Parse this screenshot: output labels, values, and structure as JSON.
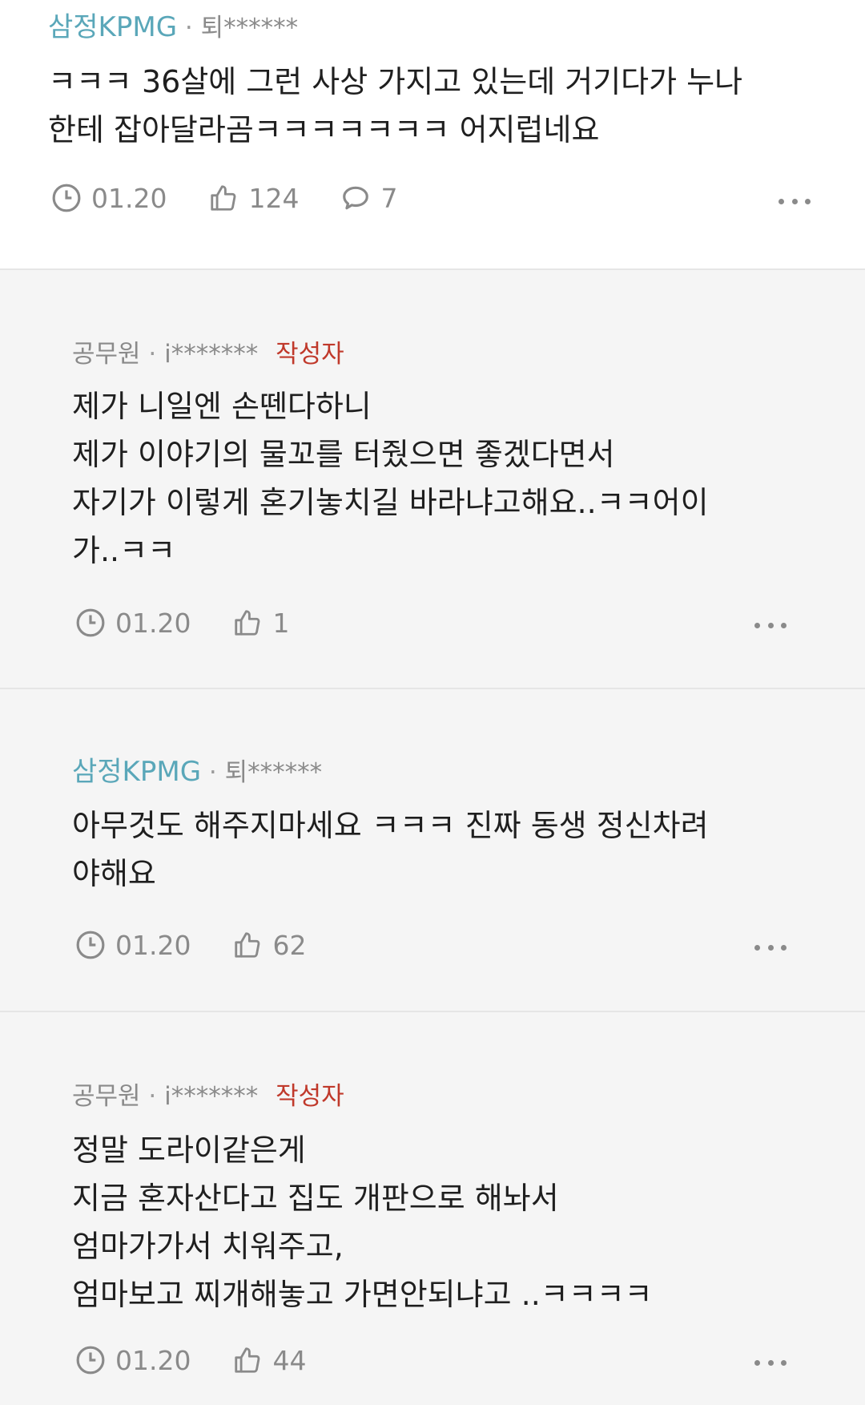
{
  "comments": [
    {
      "company": "삼정KPMG",
      "separator": "·",
      "user_id": "퇴******",
      "author_tag": "",
      "lines": [
        "ㅋㅋㅋ 36살에 그런 사상 가지고 있는데 거기다가 누나",
        "한테 잡아달라곰ㅋㅋㅋㅋㅋㅋㅋ 어지럽네요"
      ],
      "date": "01.20",
      "likes": "124",
      "replies": "7"
    },
    {
      "company": "공무원",
      "separator": "·",
      "user_id": "i*******",
      "author_tag": "작성자",
      "lines": [
        "제가 니일엔 손뗀다하니",
        "제가 이야기의 물꼬를 터줬으면 좋겠다면서",
        "자기가 이렇게 혼기놓치길 바라냐고해요..ㅋㅋ어이",
        "가..ㅋㅋ"
      ],
      "date": "01.20",
      "likes": "1"
    },
    {
      "company": "삼정KPMG",
      "separator": "·",
      "user_id": "퇴******",
      "author_tag": "",
      "lines": [
        "아무것도 해주지마세요 ㅋㅋㅋ 진짜 동생 정신차려",
        "야해요"
      ],
      "date": "01.20",
      "likes": "62"
    },
    {
      "company": "공무원",
      "separator": "·",
      "user_id": "i*******",
      "author_tag": "작성자",
      "lines": [
        "정말 도라이같은게",
        "지금 혼자산다고 집도 개판으로 해놔서",
        "엄마가가서 치워주고,",
        "엄마보고 찌개해놓고 가면안되냐고 ..ㅋㅋㅋㅋ"
      ],
      "date": "01.20",
      "likes": "44"
    }
  ],
  "icons": {
    "clock": "clock-icon",
    "like": "thumbs-up-icon",
    "reply": "speech-bubble-icon",
    "more": "more-options-icon"
  },
  "colors": {
    "company_link": "#5aa7b9",
    "author_tag": "#c0392b",
    "meta_gray": "#8a8a8a",
    "reply_background": "#f5f5f5"
  }
}
